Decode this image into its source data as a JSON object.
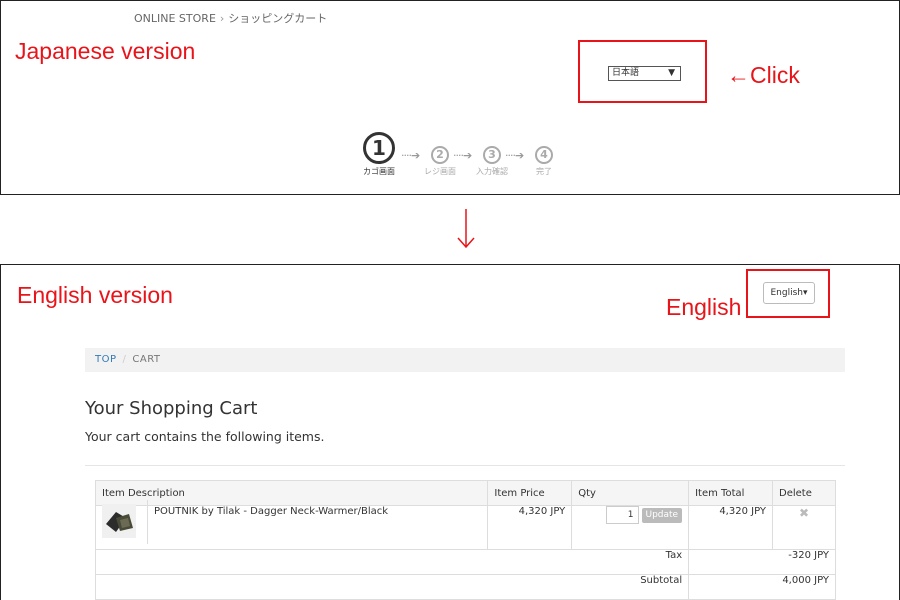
{
  "annotations": {
    "japanese_version": "Japanese version",
    "click": "←Click",
    "english_version": "English version",
    "english": "English",
    "down_arrow": "↓"
  },
  "colors": {
    "annotation": "#e8141a",
    "link": "#337ab7"
  },
  "jp_page": {
    "breadcrumb": {
      "store": "ONLINE STORE",
      "separator": "›",
      "current": "ショッピングカート"
    },
    "language_select": {
      "value": "日本語",
      "caret": "▼"
    },
    "steps": [
      {
        "number": "1",
        "label": "カゴ画面",
        "active": true
      },
      {
        "number": "2",
        "label": "レジ画面",
        "active": false
      },
      {
        "number": "3",
        "label": "入力確認",
        "active": false
      },
      {
        "number": "4",
        "label": "完了",
        "active": false
      }
    ],
    "step_connector": "····➔"
  },
  "en_page": {
    "language_button": {
      "label": "English",
      "caret": "▾"
    },
    "breadcrumb": {
      "top": "TOP",
      "separator": "/",
      "current": "CART"
    },
    "title": "Your Shopping Cart",
    "subtitle": "Your cart contains the following items.",
    "table": {
      "headers": [
        "Item Description",
        "Item Price",
        "Qty",
        "Item Total",
        "Delete"
      ],
      "items": [
        {
          "image_icon": "product-thumbnail",
          "description": "POUTNIK by Tilak - Dagger Neck-Warmer/Black",
          "price": "4,320 JPY",
          "qty": "1",
          "update_label": "Update",
          "total": "4,320 JPY",
          "delete_icon": "✖"
        }
      ],
      "tax_label": "Tax",
      "tax_value": "-320 JPY",
      "subtotal_label": "Subtotal",
      "subtotal_value": "4,000 JPY"
    }
  }
}
